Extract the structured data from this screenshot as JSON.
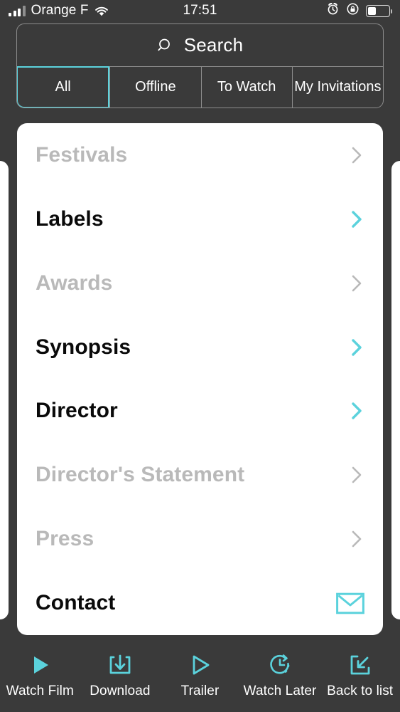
{
  "statusbar": {
    "carrier": "Orange F",
    "time": "17:51",
    "signal_icon": "signal-bars-icon",
    "wifi_icon": "wifi-icon",
    "alarm_icon": "alarm-clock-icon",
    "rotation_lock_icon": "rotation-lock-icon",
    "battery_icon": "battery-icon",
    "battery_level_pct": 40
  },
  "search": {
    "icon": "search-icon",
    "placeholder": "Search",
    "value": ""
  },
  "tabs": {
    "items": [
      {
        "label": "All",
        "active": true
      },
      {
        "label": "Offline",
        "active": false
      },
      {
        "label": "To Watch",
        "active": false
      },
      {
        "label": "My Invitations",
        "active": false
      }
    ]
  },
  "card": {
    "rows": [
      {
        "label": "Festivals",
        "enabled": false,
        "accessory": "chevron-right-icon"
      },
      {
        "label": "Labels",
        "enabled": true,
        "accessory": "chevron-right-icon"
      },
      {
        "label": "Awards",
        "enabled": false,
        "accessory": "chevron-right-icon"
      },
      {
        "label": "Synopsis",
        "enabled": true,
        "accessory": "chevron-right-icon"
      },
      {
        "label": "Director",
        "enabled": true,
        "accessory": "chevron-right-icon"
      },
      {
        "label": "Director's Statement",
        "enabled": false,
        "accessory": "chevron-right-icon"
      },
      {
        "label": "Press",
        "enabled": false,
        "accessory": "chevron-right-icon"
      },
      {
        "label": "Contact",
        "enabled": true,
        "accessory": "envelope-icon"
      }
    ]
  },
  "toolbar": {
    "items": [
      {
        "label": "Watch Film",
        "icon": "play-filled-icon"
      },
      {
        "label": "Download",
        "icon": "download-tray-icon"
      },
      {
        "label": "Trailer",
        "icon": "play-outline-icon"
      },
      {
        "label": "Watch Later",
        "icon": "clock-arrow-icon"
      },
      {
        "label": "Back to list",
        "icon": "back-to-list-icon"
      }
    ]
  },
  "colors": {
    "accent": "#5BD2DC",
    "background": "#3a3a3a",
    "card": "#ffffff",
    "disabled_text": "#b9b9b9",
    "enabled_text": "#0a0a0a"
  }
}
